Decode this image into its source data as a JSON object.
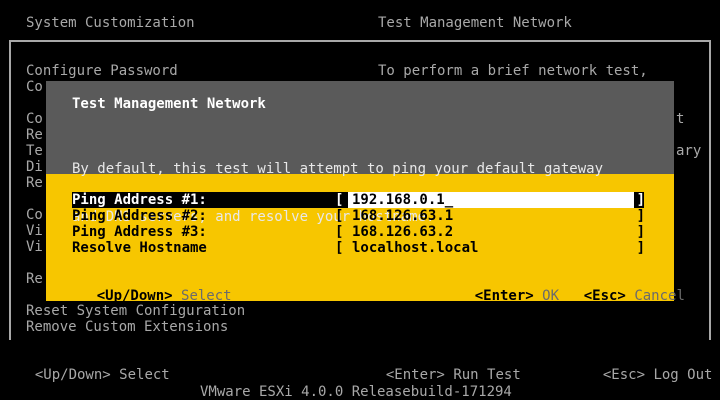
{
  "header": {
    "left_title": "System Customization",
    "right_title": "Test Management Network"
  },
  "menu": {
    "items": [
      "Configure Password",
      "Co",
      "Co",
      "Re",
      "Te",
      "Di",
      "Re",
      "Co",
      "Vi",
      "Vi",
      "Re",
      "Reset System Configuration",
      "Remove Custom Extensions"
    ]
  },
  "right_panel": {
    "line1": "To perform a brief network test,",
    "frag_a": "t",
    "frag_b": "ary"
  },
  "dialog": {
    "title": "Test Management Network",
    "description_line1": "By default, this test will attempt to ping your default gateway",
    "description_line2": "and DNS servers, and resolve your hostname.",
    "fields": [
      {
        "label": "Ping Address #1:",
        "value": "192.168.0.1"
      },
      {
        "label": "Ping Address #2:",
        "value": "168.126.63.1"
      },
      {
        "label": "Ping Address #3:",
        "value": "168.126.63.2"
      },
      {
        "label": "Resolve Hostname",
        "value": "localhost.local"
      }
    ],
    "bracket_left": "[",
    "bracket_right": "]",
    "cursor": "_",
    "footer": {
      "nav_key": "<Up/Down>",
      "nav_action": "Select",
      "ok_key": "<Enter>",
      "ok_action": "OK",
      "cancel_key": "<Esc>",
      "cancel_action": "Cancel"
    }
  },
  "footer": {
    "nav_key": "<Up/Down>",
    "nav_action": "Select",
    "run_key": "<Enter>",
    "run_action": "Run Test",
    "logout_key": "<Esc>",
    "logout_action": "Log Out"
  },
  "status_bar": {
    "text": "VMware ESXi 4.0.0 Releasebuild-171294"
  },
  "colors": {
    "background": "#000000",
    "console_text": "#a8a8a8",
    "dialog_accent": "#f7c600",
    "dialog_header": "#5a5a5a"
  }
}
